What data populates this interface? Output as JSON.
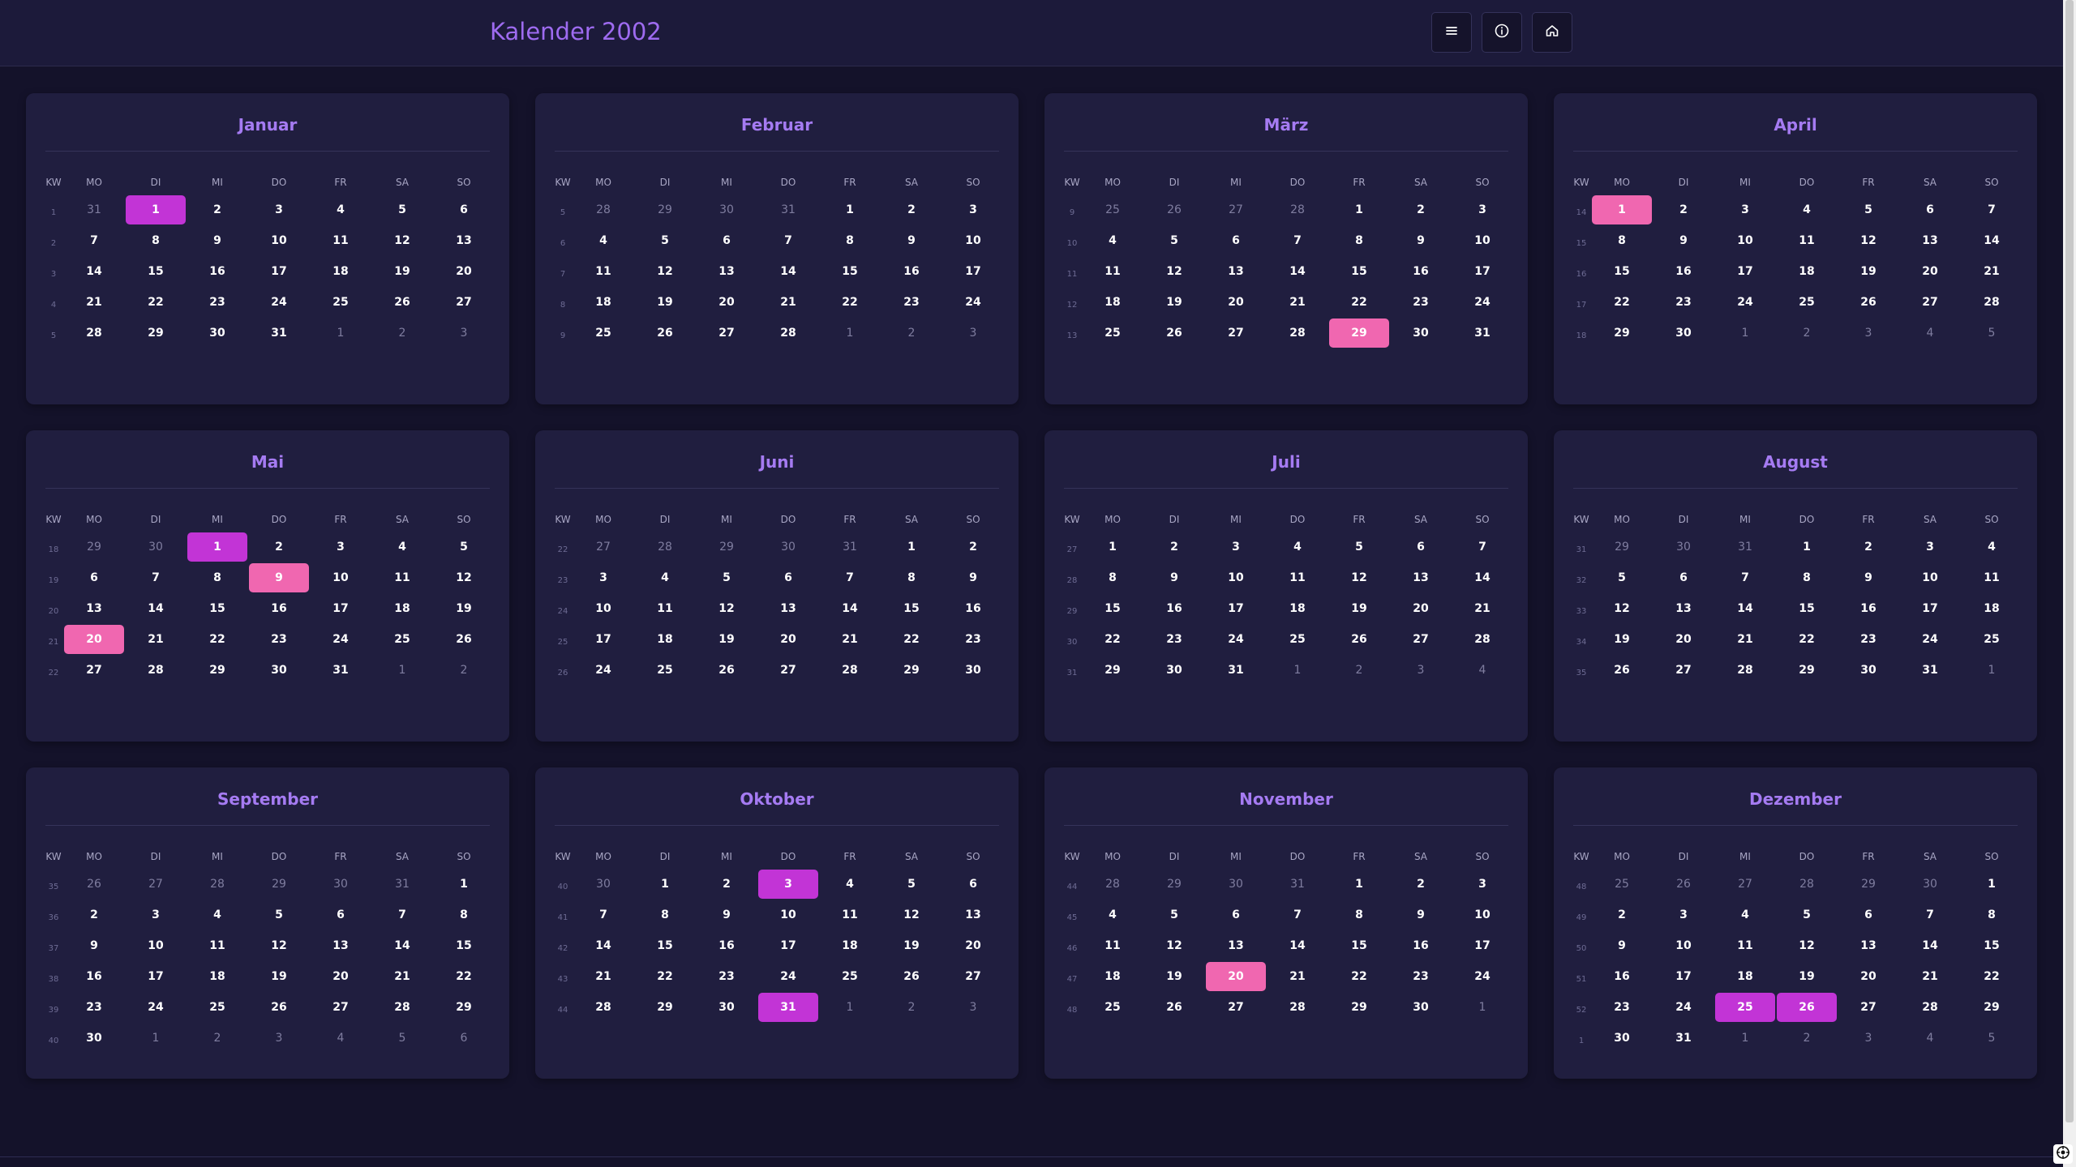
{
  "header": {
    "title": "Kalender 2002",
    "buttons": [
      {
        "icon": "menu-icon"
      },
      {
        "icon": "info-icon"
      },
      {
        "icon": "home-icon"
      }
    ]
  },
  "weekday_header": [
    "KW",
    "MO",
    "DI",
    "MI",
    "DO",
    "FR",
    "SA",
    "SO"
  ],
  "colors": {
    "background": "#14122a",
    "card": "#201e3f",
    "accent_title": "#9e6bf0",
    "holiday": "#c234d6",
    "special": "#f067b0"
  },
  "months": [
    {
      "name": "Januar",
      "weeks": [
        {
          "kw": "1",
          "days": [
            "31",
            "1",
            "2",
            "3",
            "4",
            "5",
            "6"
          ]
        },
        {
          "kw": "2",
          "days": [
            "7",
            "8",
            "9",
            "10",
            "11",
            "12",
            "13"
          ]
        },
        {
          "kw": "3",
          "days": [
            "14",
            "15",
            "16",
            "17",
            "18",
            "19",
            "20"
          ]
        },
        {
          "kw": "4",
          "days": [
            "21",
            "22",
            "23",
            "24",
            "25",
            "26",
            "27"
          ]
        },
        {
          "kw": "5",
          "days": [
            "28",
            "29",
            "30",
            "31",
            "1",
            "2",
            "3"
          ]
        }
      ],
      "lead": 1,
      "highlights": [
        {
          "day": 1,
          "type": "holiday"
        }
      ]
    },
    {
      "name": "Februar",
      "weeks": [
        {
          "kw": "5",
          "days": [
            "28",
            "29",
            "30",
            "31",
            "1",
            "2",
            "3"
          ]
        },
        {
          "kw": "6",
          "days": [
            "4",
            "5",
            "6",
            "7",
            "8",
            "9",
            "10"
          ]
        },
        {
          "kw": "7",
          "days": [
            "11",
            "12",
            "13",
            "14",
            "15",
            "16",
            "17"
          ]
        },
        {
          "kw": "8",
          "days": [
            "18",
            "19",
            "20",
            "21",
            "22",
            "23",
            "24"
          ]
        },
        {
          "kw": "9",
          "days": [
            "25",
            "26",
            "27",
            "28",
            "1",
            "2",
            "3"
          ]
        }
      ],
      "lead": 4,
      "highlights": []
    },
    {
      "name": "März",
      "weeks": [
        {
          "kw": "9",
          "days": [
            "25",
            "26",
            "27",
            "28",
            "1",
            "2",
            "3"
          ]
        },
        {
          "kw": "10",
          "days": [
            "4",
            "5",
            "6",
            "7",
            "8",
            "9",
            "10"
          ]
        },
        {
          "kw": "11",
          "days": [
            "11",
            "12",
            "13",
            "14",
            "15",
            "16",
            "17"
          ]
        },
        {
          "kw": "12",
          "days": [
            "18",
            "19",
            "20",
            "21",
            "22",
            "23",
            "24"
          ]
        },
        {
          "kw": "13",
          "days": [
            "25",
            "26",
            "27",
            "28",
            "29",
            "30",
            "31"
          ]
        }
      ],
      "lead": 4,
      "highlights": [
        {
          "day": 29,
          "type": "special"
        }
      ]
    },
    {
      "name": "April",
      "weeks": [
        {
          "kw": "14",
          "days": [
            "1",
            "2",
            "3",
            "4",
            "5",
            "6",
            "7"
          ]
        },
        {
          "kw": "15",
          "days": [
            "8",
            "9",
            "10",
            "11",
            "12",
            "13",
            "14"
          ]
        },
        {
          "kw": "16",
          "days": [
            "15",
            "16",
            "17",
            "18",
            "19",
            "20",
            "21"
          ]
        },
        {
          "kw": "17",
          "days": [
            "22",
            "23",
            "24",
            "25",
            "26",
            "27",
            "28"
          ]
        },
        {
          "kw": "18",
          "days": [
            "29",
            "30",
            "1",
            "2",
            "3",
            "4",
            "5"
          ]
        }
      ],
      "lead": 0,
      "highlights": [
        {
          "day": 1,
          "type": "special"
        }
      ]
    },
    {
      "name": "Mai",
      "weeks": [
        {
          "kw": "18",
          "days": [
            "29",
            "30",
            "1",
            "2",
            "3",
            "4",
            "5"
          ]
        },
        {
          "kw": "19",
          "days": [
            "6",
            "7",
            "8",
            "9",
            "10",
            "11",
            "12"
          ]
        },
        {
          "kw": "20",
          "days": [
            "13",
            "14",
            "15",
            "16",
            "17",
            "18",
            "19"
          ]
        },
        {
          "kw": "21",
          "days": [
            "20",
            "21",
            "22",
            "23",
            "24",
            "25",
            "26"
          ]
        },
        {
          "kw": "22",
          "days": [
            "27",
            "28",
            "29",
            "30",
            "31",
            "1",
            "2"
          ]
        }
      ],
      "lead": 2,
      "highlights": [
        {
          "day": 1,
          "type": "holiday"
        },
        {
          "day": 9,
          "type": "special"
        },
        {
          "day": 20,
          "type": "special"
        }
      ]
    },
    {
      "name": "Juni",
      "weeks": [
        {
          "kw": "22",
          "days": [
            "27",
            "28",
            "29",
            "30",
            "31",
            "1",
            "2"
          ]
        },
        {
          "kw": "23",
          "days": [
            "3",
            "4",
            "5",
            "6",
            "7",
            "8",
            "9"
          ]
        },
        {
          "kw": "24",
          "days": [
            "10",
            "11",
            "12",
            "13",
            "14",
            "15",
            "16"
          ]
        },
        {
          "kw": "25",
          "days": [
            "17",
            "18",
            "19",
            "20",
            "21",
            "22",
            "23"
          ]
        },
        {
          "kw": "26",
          "days": [
            "24",
            "25",
            "26",
            "27",
            "28",
            "29",
            "30"
          ]
        }
      ],
      "lead": 5,
      "highlights": []
    },
    {
      "name": "Juli",
      "weeks": [
        {
          "kw": "27",
          "days": [
            "1",
            "2",
            "3",
            "4",
            "5",
            "6",
            "7"
          ]
        },
        {
          "kw": "28",
          "days": [
            "8",
            "9",
            "10",
            "11",
            "12",
            "13",
            "14"
          ]
        },
        {
          "kw": "29",
          "days": [
            "15",
            "16",
            "17",
            "18",
            "19",
            "20",
            "21"
          ]
        },
        {
          "kw": "30",
          "days": [
            "22",
            "23",
            "24",
            "25",
            "26",
            "27",
            "28"
          ]
        },
        {
          "kw": "31",
          "days": [
            "29",
            "30",
            "31",
            "1",
            "2",
            "3",
            "4"
          ]
        }
      ],
      "lead": 0,
      "highlights": []
    },
    {
      "name": "August",
      "weeks": [
        {
          "kw": "31",
          "days": [
            "29",
            "30",
            "31",
            "1",
            "2",
            "3",
            "4"
          ]
        },
        {
          "kw": "32",
          "days": [
            "5",
            "6",
            "7",
            "8",
            "9",
            "10",
            "11"
          ]
        },
        {
          "kw": "33",
          "days": [
            "12",
            "13",
            "14",
            "15",
            "16",
            "17",
            "18"
          ]
        },
        {
          "kw": "34",
          "days": [
            "19",
            "20",
            "21",
            "22",
            "23",
            "24",
            "25"
          ]
        },
        {
          "kw": "35",
          "days": [
            "26",
            "27",
            "28",
            "29",
            "30",
            "31",
            "1"
          ]
        }
      ],
      "lead": 3,
      "highlights": []
    },
    {
      "name": "September",
      "weeks": [
        {
          "kw": "35",
          "days": [
            "26",
            "27",
            "28",
            "29",
            "30",
            "31",
            "1"
          ]
        },
        {
          "kw": "36",
          "days": [
            "2",
            "3",
            "4",
            "5",
            "6",
            "7",
            "8"
          ]
        },
        {
          "kw": "37",
          "days": [
            "9",
            "10",
            "11",
            "12",
            "13",
            "14",
            "15"
          ]
        },
        {
          "kw": "38",
          "days": [
            "16",
            "17",
            "18",
            "19",
            "20",
            "21",
            "22"
          ]
        },
        {
          "kw": "39",
          "days": [
            "23",
            "24",
            "25",
            "26",
            "27",
            "28",
            "29"
          ]
        },
        {
          "kw": "40",
          "days": [
            "30",
            "1",
            "2",
            "3",
            "4",
            "5",
            "6"
          ]
        }
      ],
      "lead": 6,
      "highlights": []
    },
    {
      "name": "Oktober",
      "weeks": [
        {
          "kw": "40",
          "days": [
            "30",
            "1",
            "2",
            "3",
            "4",
            "5",
            "6"
          ]
        },
        {
          "kw": "41",
          "days": [
            "7",
            "8",
            "9",
            "10",
            "11",
            "12",
            "13"
          ]
        },
        {
          "kw": "42",
          "days": [
            "14",
            "15",
            "16",
            "17",
            "18",
            "19",
            "20"
          ]
        },
        {
          "kw": "43",
          "days": [
            "21",
            "22",
            "23",
            "24",
            "25",
            "26",
            "27"
          ]
        },
        {
          "kw": "44",
          "days": [
            "28",
            "29",
            "30",
            "31",
            "1",
            "2",
            "3"
          ]
        }
      ],
      "lead": 1,
      "highlights": [
        {
          "day": 3,
          "type": "holiday"
        },
        {
          "day": 31,
          "type": "holiday"
        }
      ]
    },
    {
      "name": "November",
      "weeks": [
        {
          "kw": "44",
          "days": [
            "28",
            "29",
            "30",
            "31",
            "1",
            "2",
            "3"
          ]
        },
        {
          "kw": "45",
          "days": [
            "4",
            "5",
            "6",
            "7",
            "8",
            "9",
            "10"
          ]
        },
        {
          "kw": "46",
          "days": [
            "11",
            "12",
            "13",
            "14",
            "15",
            "16",
            "17"
          ]
        },
        {
          "kw": "47",
          "days": [
            "18",
            "19",
            "20",
            "21",
            "22",
            "23",
            "24"
          ]
        },
        {
          "kw": "48",
          "days": [
            "25",
            "26",
            "27",
            "28",
            "29",
            "30",
            "1"
          ]
        }
      ],
      "lead": 4,
      "highlights": [
        {
          "day": 20,
          "type": "special"
        }
      ]
    },
    {
      "name": "Dezember",
      "weeks": [
        {
          "kw": "48",
          "days": [
            "25",
            "26",
            "27",
            "28",
            "29",
            "30",
            "1"
          ]
        },
        {
          "kw": "49",
          "days": [
            "2",
            "3",
            "4",
            "5",
            "6",
            "7",
            "8"
          ]
        },
        {
          "kw": "50",
          "days": [
            "9",
            "10",
            "11",
            "12",
            "13",
            "14",
            "15"
          ]
        },
        {
          "kw": "51",
          "days": [
            "16",
            "17",
            "18",
            "19",
            "20",
            "21",
            "22"
          ]
        },
        {
          "kw": "52",
          "days": [
            "23",
            "24",
            "25",
            "26",
            "27",
            "28",
            "29"
          ]
        },
        {
          "kw": "1",
          "days": [
            "30",
            "31",
            "1",
            "2",
            "3",
            "4",
            "5"
          ]
        }
      ],
      "lead": 6,
      "highlights": [
        {
          "day": 25,
          "type": "holiday"
        },
        {
          "day": 26,
          "type": "holiday"
        }
      ]
    }
  ]
}
